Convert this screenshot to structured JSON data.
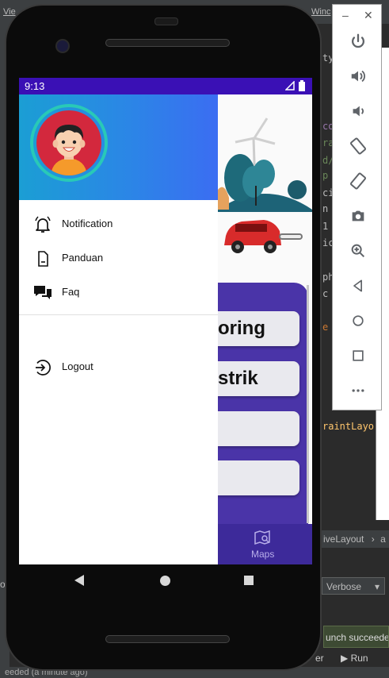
{
  "ide": {
    "menu_left": "Vie",
    "menu_right": "Winc",
    "code_lines": [
      "ty",
      "co",
      "ra",
      "d/",
      "p",
      "ci",
      "n",
      "1",
      "ic",
      "ph",
      "c",
      "e"
    ],
    "constraint_text": "raintLayo",
    "breadcrumb": "iveLayout",
    "breadcrumb_sep": "›",
    "breadcrumb_tail": "a",
    "left_marker": "o",
    "log_level": "Verbose",
    "toast": "unch succeeded",
    "run_tab": "Run",
    "run_prefix": "er",
    "status": "eeded (a minute ago)"
  },
  "emulator_toolbar": {
    "minimize_icon": "minimize-icon",
    "close_icon": "close-icon",
    "buttons": [
      "power-icon",
      "volume-up-icon",
      "volume-down-icon",
      "rotate-left-icon",
      "rotate-right-icon",
      "camera-icon",
      "zoom-icon",
      "back-icon",
      "home-icon",
      "overview-icon",
      "more-icon"
    ]
  },
  "statusbar": {
    "time": "9:13"
  },
  "app": {
    "buttons": [
      "oring",
      "strik",
      "",
      ""
    ],
    "nav_label": "Maps"
  },
  "drawer": {
    "menu": [
      {
        "label": "Notification",
        "icon": "bell-icon"
      },
      {
        "label": "Panduan",
        "icon": "document-icon"
      },
      {
        "label": "Faq",
        "icon": "chat-icon"
      }
    ],
    "logout": {
      "label": "Logout",
      "icon": "logout-icon"
    }
  },
  "colors": {
    "statusbar": "#3a10b5",
    "header_start": "#1b9ed4",
    "header_end": "#3b6df2",
    "avatar_ring": "#29c9b7",
    "avatar_bg": "#d3283d"
  }
}
